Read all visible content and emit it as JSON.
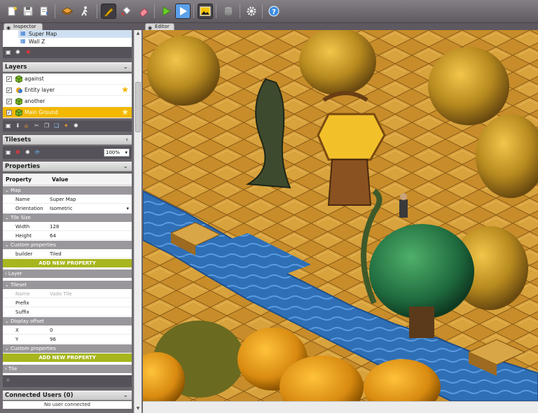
{
  "toolbar": {
    "icons": [
      "new-icon",
      "save-icon",
      "export-icon",
      "layer-tool-icon",
      "walk-icon",
      "pencil-icon",
      "fill-icon",
      "eraser-icon",
      "play-icon",
      "play-step-icon",
      "image-icon",
      "database-icon",
      "settings-icon",
      "help-icon"
    ]
  },
  "tabs": {
    "inspector": "Inspector",
    "editor": "Editor"
  },
  "tree": {
    "items": [
      "Super Map",
      "Wall Z"
    ]
  },
  "layers": {
    "title": "Layers",
    "items": [
      {
        "label": "against",
        "checked": true,
        "star": false
      },
      {
        "label": "Entity layer",
        "checked": true,
        "star": true
      },
      {
        "label": "another",
        "checked": true,
        "star": false
      },
      {
        "label": "Main Ground",
        "checked": true,
        "star": true,
        "selected": true
      }
    ]
  },
  "tilesets": {
    "title": "Tilesets",
    "zoom": "100%"
  },
  "properties": {
    "title": "Properties",
    "col_property": "Property",
    "col_value": "Value",
    "map_section": "Map",
    "name_key": "Name",
    "name_value": "Super Map",
    "orientation_key": "Orientation",
    "orientation_value": "Isometric",
    "tile_size_section": "Tile Size",
    "width_key": "Width",
    "width_value": "128",
    "height_key": "Height",
    "height_value": "64",
    "custom_section": "Custom properties",
    "builder_key": "builder",
    "builder_value": "Tiled",
    "add_label": "ADD NEW PROPERTY",
    "layer_section": "Layer",
    "tileset_section": "Tileset",
    "ts_name_key": "Name",
    "ts_name_value": "Vado Tile",
    "prefix_key": "Prefix",
    "suffix_key": "Suffix",
    "offset_section": "Display offset",
    "x_key": "X",
    "x_value": "0",
    "y_key": "Y",
    "y_value": "96",
    "custom_section2": "Custom properties",
    "add_label2": "ADD NEW PROPERTY",
    "tile_section": "Tile"
  },
  "connected": {
    "title": "Connected Users (0)",
    "status": "No user connected"
  },
  "colors": {
    "accent": "#f2b800",
    "add_button": "#a7b61e",
    "water": "#2f6fb6"
  }
}
